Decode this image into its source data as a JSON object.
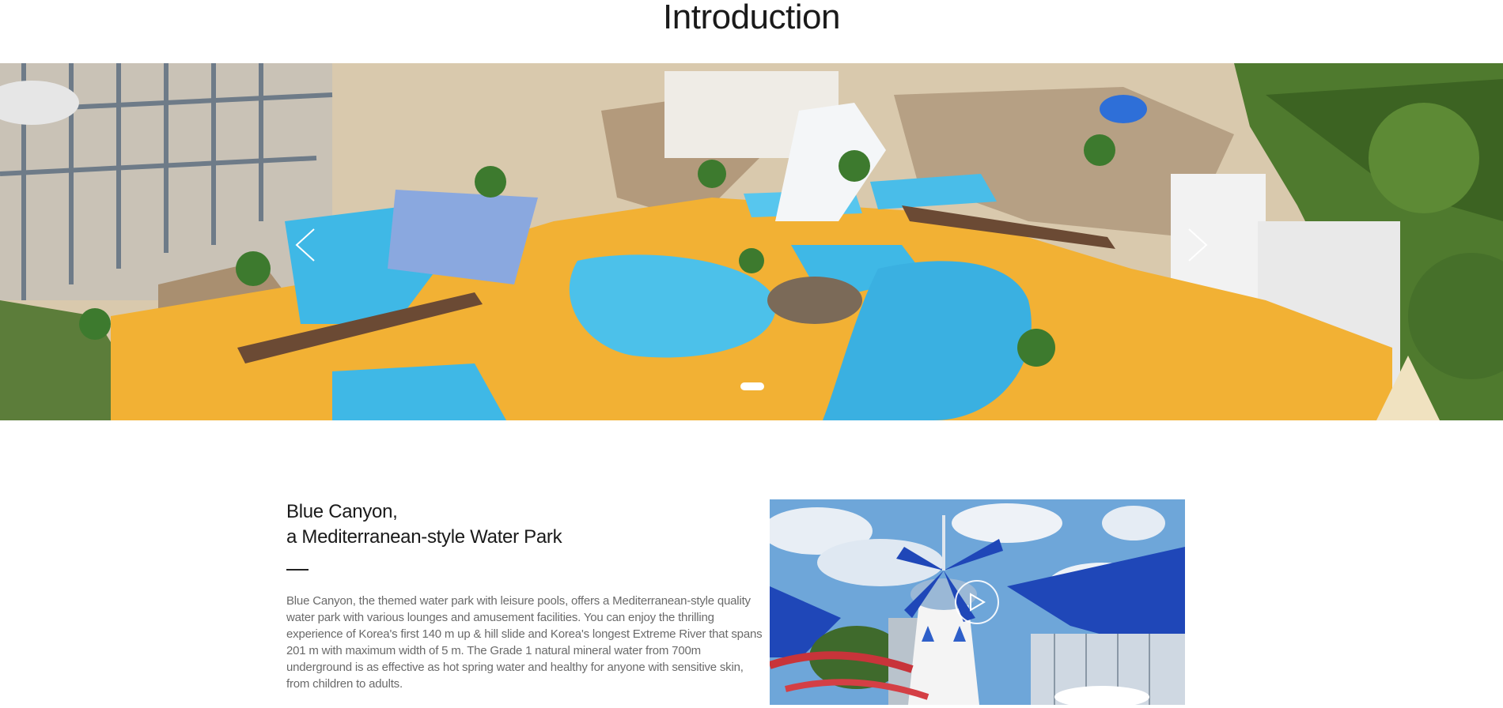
{
  "page": {
    "title": "Introduction"
  },
  "hero": {
    "prev_icon": "chevron-left-icon",
    "next_icon": "chevron-right-icon",
    "slide_count": 1,
    "active_slide": 1
  },
  "intro": {
    "heading_line1": "Blue Canyon,",
    "heading_line2": "a Mediterranean-style Water Park",
    "body": "Blue Canyon, the themed water park with leisure pools, offers a Mediterranean-style quality water park with various lounges and amusement facilities. You can enjoy the thrilling experience of Korea's first 140 m up & hill slide and Korea's longest Extreme River that spans 201 m with maximum width of 5 m. The Grade 1 natural mineral water from 700m underground is as effective as hot spring water and healthy for anyone with sensitive skin, from children to adults."
  },
  "video": {
    "play_icon": "play-icon"
  },
  "colors": {
    "pool": "#3fb8e6",
    "deck": "#f2b134",
    "rock": "#b39a7c",
    "forest": "#4f7a2e",
    "sky": "#6ea6d9",
    "canopy": "#1f47b8"
  }
}
